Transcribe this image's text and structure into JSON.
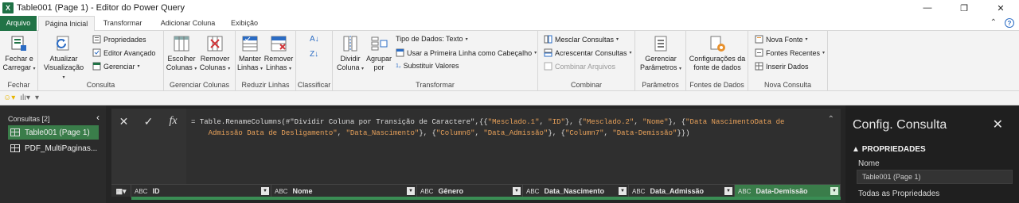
{
  "window": {
    "app_icon": "X",
    "title": "Table001 (Page 1) - Editor do Power Query",
    "min": "—",
    "restore": "❐",
    "close": "✕"
  },
  "tabs": [
    "Arquivo",
    "Página Inicial",
    "Transformar",
    "Adicionar Coluna",
    "Exibição"
  ],
  "ribbon": {
    "fechar": {
      "group": "Fechar",
      "btn_line1": "Fechar e",
      "btn_line2": "Carregar"
    },
    "consulta": {
      "group": "Consulta",
      "atualizar_1": "Atualizar",
      "atualizar_2": "Visualização",
      "propriedades": "Propriedades",
      "editor_avancado": "Editor Avançado",
      "gerenciar": "Gerenciar"
    },
    "gerenciar_colunas": {
      "group": "Gerenciar Colunas",
      "escolher_1": "Escolher",
      "escolher_2": "Colunas",
      "remover_1": "Remover",
      "remover_2": "Colunas"
    },
    "reduzir_linhas": {
      "group": "Reduzir Linhas",
      "manter_1": "Manter",
      "manter_2": "Linhas",
      "remover_1": "Remover",
      "remover_2": "Linhas"
    },
    "classificar": {
      "group": "Classificar"
    },
    "transformar": {
      "group": "Transformar",
      "dividir_1": "Dividir",
      "dividir_2": "Coluna",
      "agrupar_1": "Agrupar",
      "agrupar_2": "por",
      "tipo_dados": "Tipo de Dados: Texto",
      "primeira_linha": "Usar a Primeira Linha como Cabeçalho",
      "substituir": "Substituir Valores"
    },
    "combinar": {
      "group": "Combinar",
      "mesclar": "Mesclar Consultas",
      "acrescentar": "Acrescentar Consultas",
      "combinar_arquivos": "Combinar Arquivos"
    },
    "parametros": {
      "group": "Parâmetros",
      "btn_1": "Gerenciar",
      "btn_2": "Parâmetros"
    },
    "fontes_dados": {
      "group": "Fontes de Dados",
      "btn_1": "Configurações da",
      "btn_2": "fonte de dados"
    },
    "nova_consulta": {
      "group": "Nova Consulta",
      "nova_fonte": "Nova Fonte",
      "fontes_recentes": "Fontes Recentes",
      "inserir_dados": "Inserir Dados"
    }
  },
  "queries": {
    "header": "Consultas [2]",
    "items": [
      "Table001 (Page 1)",
      "PDF_MultiPaginas..."
    ]
  },
  "formula": {
    "prefix": "= Table.RenameColumns(#\"Dividir Coluna por Transição de Caractere\",{{",
    "s1": "\"Mesclado.1\"",
    "s2": "\"ID\"",
    "s3": "\"Mesclado.2\"",
    "s4": "\"Nome\"",
    "s5": "\"Data NascimentoData de",
    "s5b": "    Admissão Data de Desligamento\"",
    "s6": "\"Data_Nascimento\"",
    "s7": "\"Column6\"",
    "s8": "\"Data_Admissão\"",
    "s9": "\"Column7\"",
    "s10": "\"Data-Demissão\"",
    "end": "}})"
  },
  "columns": [
    "ID",
    "Nome",
    "Gênero",
    "Data_Nascimento",
    "Data_Admissão",
    "Data-Demissão"
  ],
  "config": {
    "title": "Config. Consulta",
    "propriedades": "PROPRIEDADES",
    "nome_label": "Nome",
    "nome_value": "Table001 (Page 1)",
    "todas": "Todas as Propriedades"
  },
  "colors": {
    "excel_green": "#217346",
    "selected_green": "#3a7d4a",
    "string_orange": "#e8a15a"
  }
}
